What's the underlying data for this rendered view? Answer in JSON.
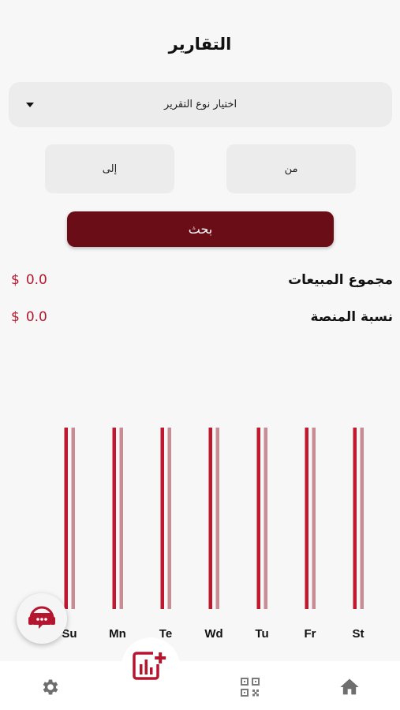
{
  "header": {
    "title": "التقارير"
  },
  "report_select": {
    "placeholder": "اختيار نوع التقرير"
  },
  "date_range": {
    "from_label": "من",
    "to_label": "إلى"
  },
  "search": {
    "label": "بحث"
  },
  "stats": {
    "total_sales": {
      "label": "مجموع المبيعات",
      "value": "0.0",
      "currency": "$"
    },
    "platform_share": {
      "label": "نسبة المنصة",
      "value": "0.0",
      "currency": "$"
    }
  },
  "chart_data": {
    "type": "bar",
    "categories": [
      "Su",
      "Mn",
      "Te",
      "Wd",
      "Tu",
      "Fr",
      "St"
    ],
    "series": [
      {
        "values": [
          0,
          0,
          0,
          0,
          0,
          0,
          0
        ],
        "color": "#c0182f"
      },
      {
        "values": [
          0,
          0,
          0,
          0,
          0,
          0,
          0
        ],
        "color": "#c88c95"
      }
    ]
  },
  "colors": {
    "accent": "#6a0d17",
    "value_red": "#b5162f"
  },
  "icons": {
    "support": "support-chat-icon",
    "center": "add-report-icon",
    "settings": "gear-icon",
    "qr": "qr-code-icon",
    "home": "home-icon"
  }
}
